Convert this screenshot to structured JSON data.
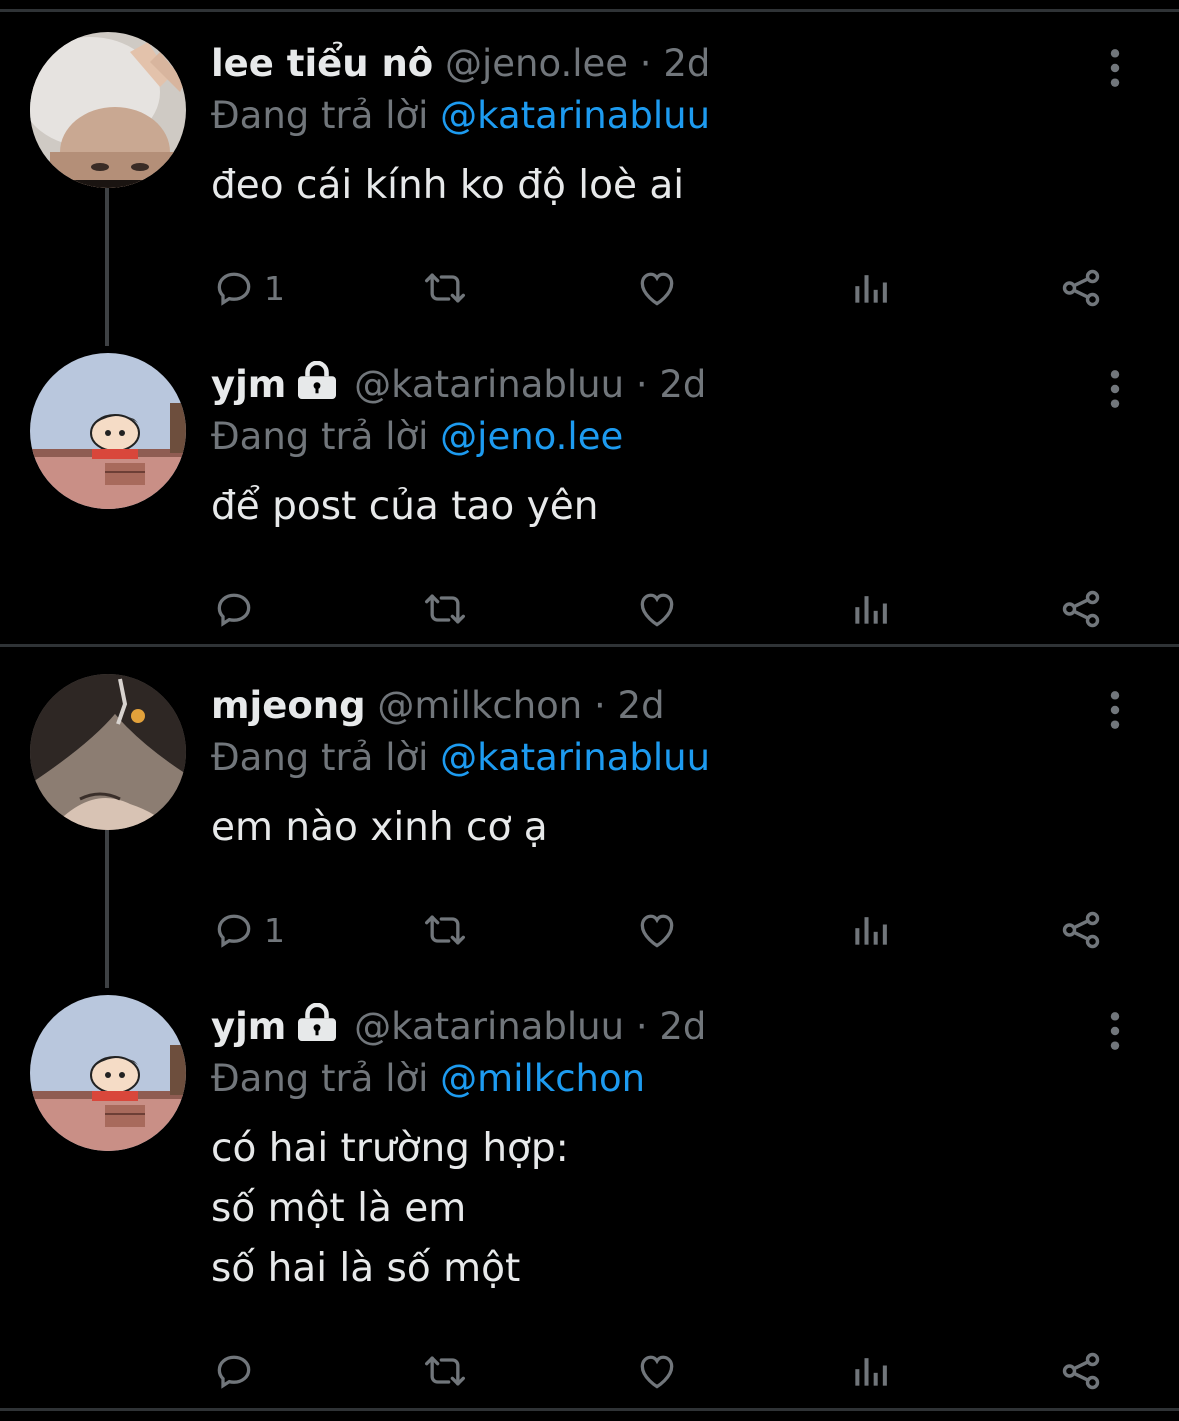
{
  "tweets": [
    {
      "name": "lee tiểu nô",
      "handle": "@jeno.lee",
      "time": "· 2d",
      "locked": false,
      "reply_prefix": "Đang trả lời",
      "reply_to": "@katarinabluu",
      "lines": [
        "đeo cái kính ko độ loè ai"
      ],
      "reply_count": "1",
      "avatar": "avatar-peace-sign"
    },
    {
      "name": "yjm",
      "handle": "@katarinabluu",
      "time": "· 2d",
      "locked": true,
      "reply_prefix": "Đang trả lời",
      "reply_to": "@jeno.lee",
      "lines": [
        "để post của tao yên"
      ],
      "reply_count": "",
      "avatar": "avatar-cartoon"
    },
    {
      "name": "mjeong",
      "handle": "@milkchon",
      "time": "· 2d",
      "locked": false,
      "reply_prefix": "Đang trả lời",
      "reply_to": "@katarinabluu",
      "lines": [
        "em nào xinh cơ ạ"
      ],
      "reply_count": "1",
      "avatar": "avatar-hair"
    },
    {
      "name": "yjm",
      "handle": "@katarinabluu",
      "time": "· 2d",
      "locked": true,
      "reply_prefix": "Đang trả lời",
      "reply_to": "@milkchon",
      "lines": [
        "có hai trường hợp:",
        "số một là em",
        "số hai là số một"
      ],
      "reply_count": "",
      "avatar": "avatar-cartoon"
    }
  ],
  "icons": {
    "reply": "reply-icon",
    "retweet": "retweet-icon",
    "like": "heart-icon",
    "views": "views-icon",
    "share": "share-icon",
    "more": "more-options-icon",
    "lock": "lock-icon"
  },
  "colors": {
    "background": "#000000",
    "text": "#e7e9ea",
    "secondary": "#71767b",
    "link": "#1d9bf0",
    "divider": "#2f3336"
  }
}
